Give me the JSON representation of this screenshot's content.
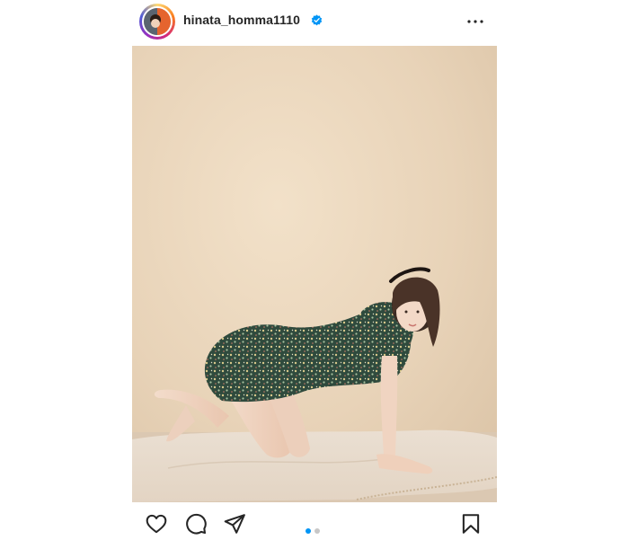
{
  "post": {
    "username": "hinata_homma1110",
    "verified": true,
    "carousel": {
      "total_slides": 2,
      "active_slide": 1
    }
  },
  "icons": {
    "verified": "verified-badge-icon",
    "more": "more-options-icon",
    "like": "heart-icon",
    "comment": "comment-icon",
    "share": "send-icon",
    "save": "bookmark-icon"
  },
  "colors": {
    "verified_blue": "#0095f6",
    "active_dot": "#0095f6",
    "inactive_dot": "#c7c7c7",
    "text": "#262626",
    "wall": "#ead7bd",
    "floor_cloth": "#ece0d2"
  }
}
